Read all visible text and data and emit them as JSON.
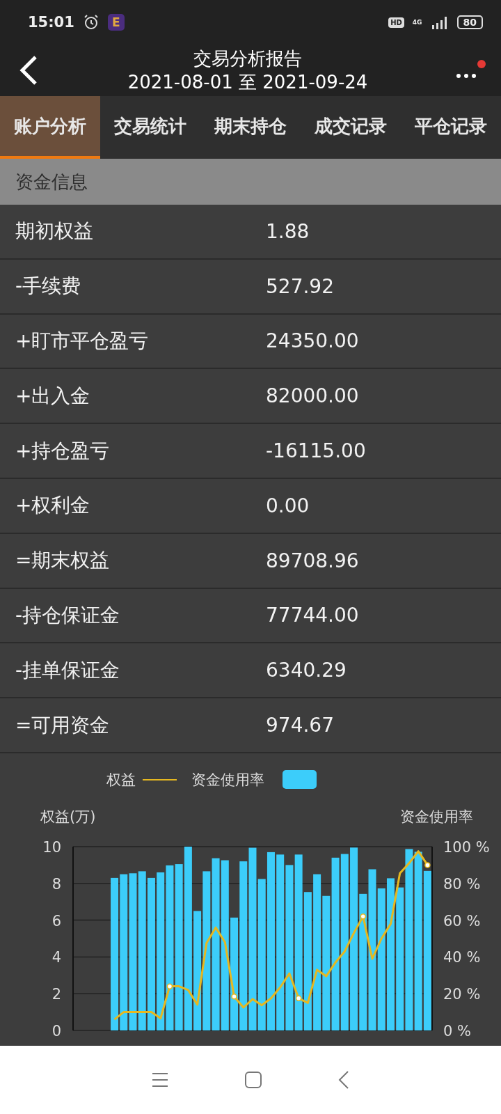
{
  "status_bar": {
    "time": "15:01",
    "app_badge": "E",
    "hd": "HD",
    "network": "4G",
    "battery": "80"
  },
  "header": {
    "title": "交易分析报告",
    "subtitle": "2021-08-01 至 2021-09-24",
    "notification": true
  },
  "tabs": [
    {
      "label": "账户分析",
      "selected": true
    },
    {
      "label": "交易统计",
      "selected": false
    },
    {
      "label": "期末持仓",
      "selected": false
    },
    {
      "label": "成交记录",
      "selected": false
    },
    {
      "label": "平仓记录",
      "selected": false
    }
  ],
  "section_title": "资金信息",
  "rows": [
    {
      "label": "期初权益",
      "value": "1.88"
    },
    {
      "label": "-手续费",
      "value": "527.92"
    },
    {
      "label": "+盯市平仓盈亏",
      "value": "24350.00"
    },
    {
      "label": "+出入金",
      "value": "82000.00"
    },
    {
      "label": "+持仓盈亏",
      "value": "-16115.00"
    },
    {
      "label": "+权利金",
      "value": "0.00"
    },
    {
      "label": "=期末权益",
      "value": "89708.96"
    },
    {
      "label": "-持仓保证金",
      "value": "77744.00"
    },
    {
      "label": "-挂单保证金",
      "value": "6340.29"
    },
    {
      "label": "=可用资金",
      "value": "974.67"
    }
  ],
  "chart": {
    "equity": {
      "chart_data": {
        "type": "line",
        "ylabel": "权益(万)",
        "ylim": [
          0,
          10
        ],
        "yticks": [
          0,
          2,
          4,
          6,
          8,
          10
        ],
        "series": [
          {
            "name": "权益",
            "color": "#e6b820",
            "values": [
              null,
              null,
              null,
              null,
              0.6,
              1.0,
              1.0,
              1.0,
              1.0,
              0.66,
              2.4,
              2.4,
              2.2,
              1.4,
              4.75,
              5.6,
              4.8,
              1.85,
              1.25,
              1.7,
              1.37,
              1.75,
              2.35,
              3.1,
              1.75,
              1.5,
              3.3,
              2.95,
              3.7,
              4.3,
              5.3,
              6.2,
              3.9,
              5.0,
              5.8,
              8.55,
              9.1,
              9.75,
              9.0
            ]
          }
        ]
      }
    },
    "usage": {
      "chart_data": {
        "type": "bar",
        "ylabel": "资金使用率",
        "ylim": [
          0,
          100
        ],
        "grid": true,
        "yticks": [
          {
            "value": 0,
            "label": "0 %"
          },
          {
            "value": 20,
            "label": "20 %"
          },
          {
            "value": 40,
            "label": "40 %"
          },
          {
            "value": 60,
            "label": "60 %"
          },
          {
            "value": 80,
            "label": "80 %"
          },
          {
            "value": 100,
            "label": "100 %"
          }
        ],
        "series": [
          {
            "name": "资金使用率",
            "color": "#3ccdfa",
            "values": [
              null,
              null,
              null,
              null,
              83,
              85,
              85.5,
              86.6,
              83,
              86,
              89.8,
              90.5,
              100,
              65,
              86.6,
              93.7,
              92.6,
              61.4,
              92,
              99.4,
              82.4,
              97,
              95.7,
              90,
              95.7,
              75.3,
              85,
              73.2,
              94,
              96,
              99.5,
              74.3,
              87.7,
              77.3,
              82.8,
              77.8,
              98.7,
              97.2,
              86.8
            ]
          }
        ]
      }
    }
  }
}
